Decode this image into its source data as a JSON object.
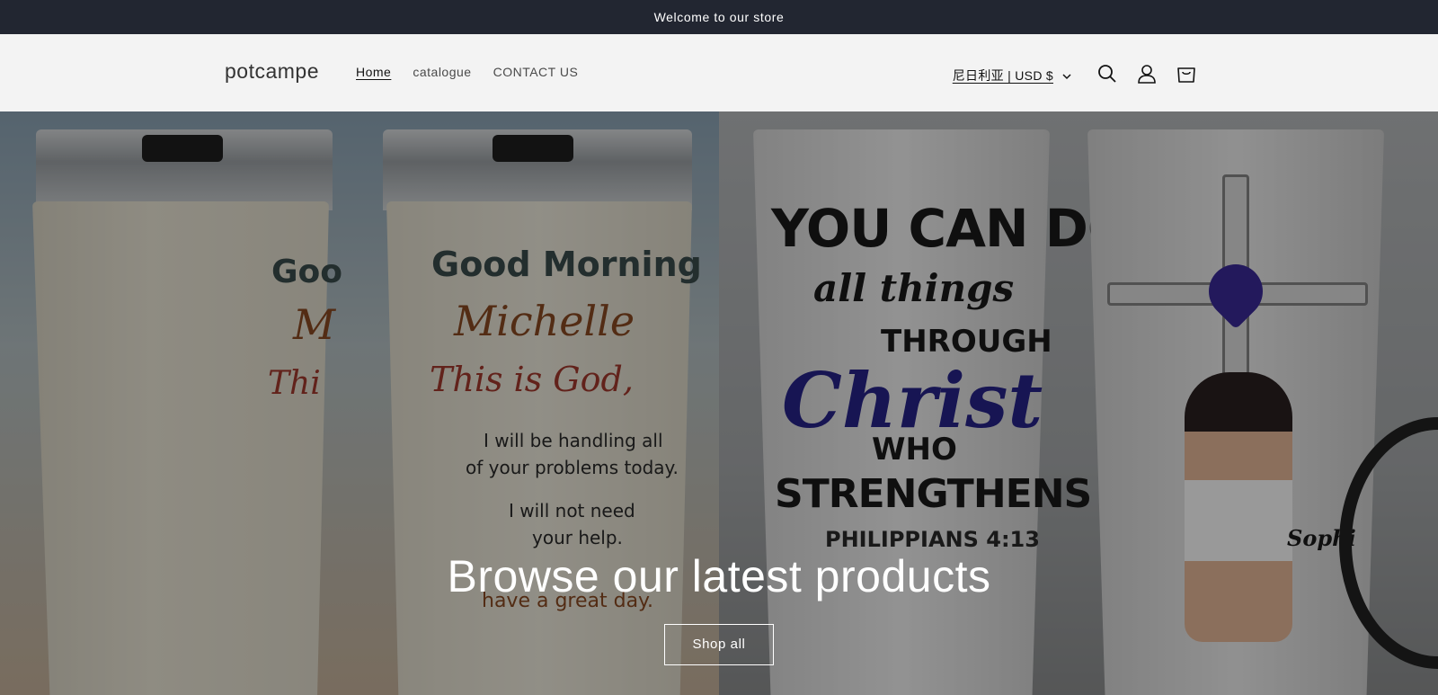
{
  "announcement": {
    "text": "Welcome to our store"
  },
  "header": {
    "logo": "potcampe",
    "nav": [
      {
        "label": "Home",
        "active": true
      },
      {
        "label": "catalogue",
        "active": false
      },
      {
        "label": "CONTACT US",
        "active": false
      }
    ],
    "localization": "尼日利亚 | USD $",
    "icons": [
      "search-icon",
      "account-icon",
      "cart-icon",
      "chevron-down-icon"
    ]
  },
  "hero": {
    "title": "Browse our latest products",
    "button_label": "Shop all",
    "image_text_left": {
      "heading": "Good Morning",
      "name": "Michelle",
      "line1": "This is God,",
      "line2": "I will be handling all",
      "line3": "of your problems today.",
      "line4": "I will not need",
      "line5": "your help.",
      "line6": "have a great day.",
      "partial_heading": "Goo",
      "partial_name": "M",
      "partial_line": "Thi"
    },
    "image_text_right": {
      "line1": "YOU CAN DO",
      "line2": "all things",
      "line3": "THROUGH",
      "line4": "Christ",
      "line5": "WHO",
      "line6": "STRENGTHENS YOU",
      "line7": "PHILIPPIANS 4:13",
      "name": "Sophi"
    }
  },
  "colors": {
    "announcement_bg": "#222631",
    "header_bg": "#f3f3f3",
    "overlay": "#000000"
  }
}
